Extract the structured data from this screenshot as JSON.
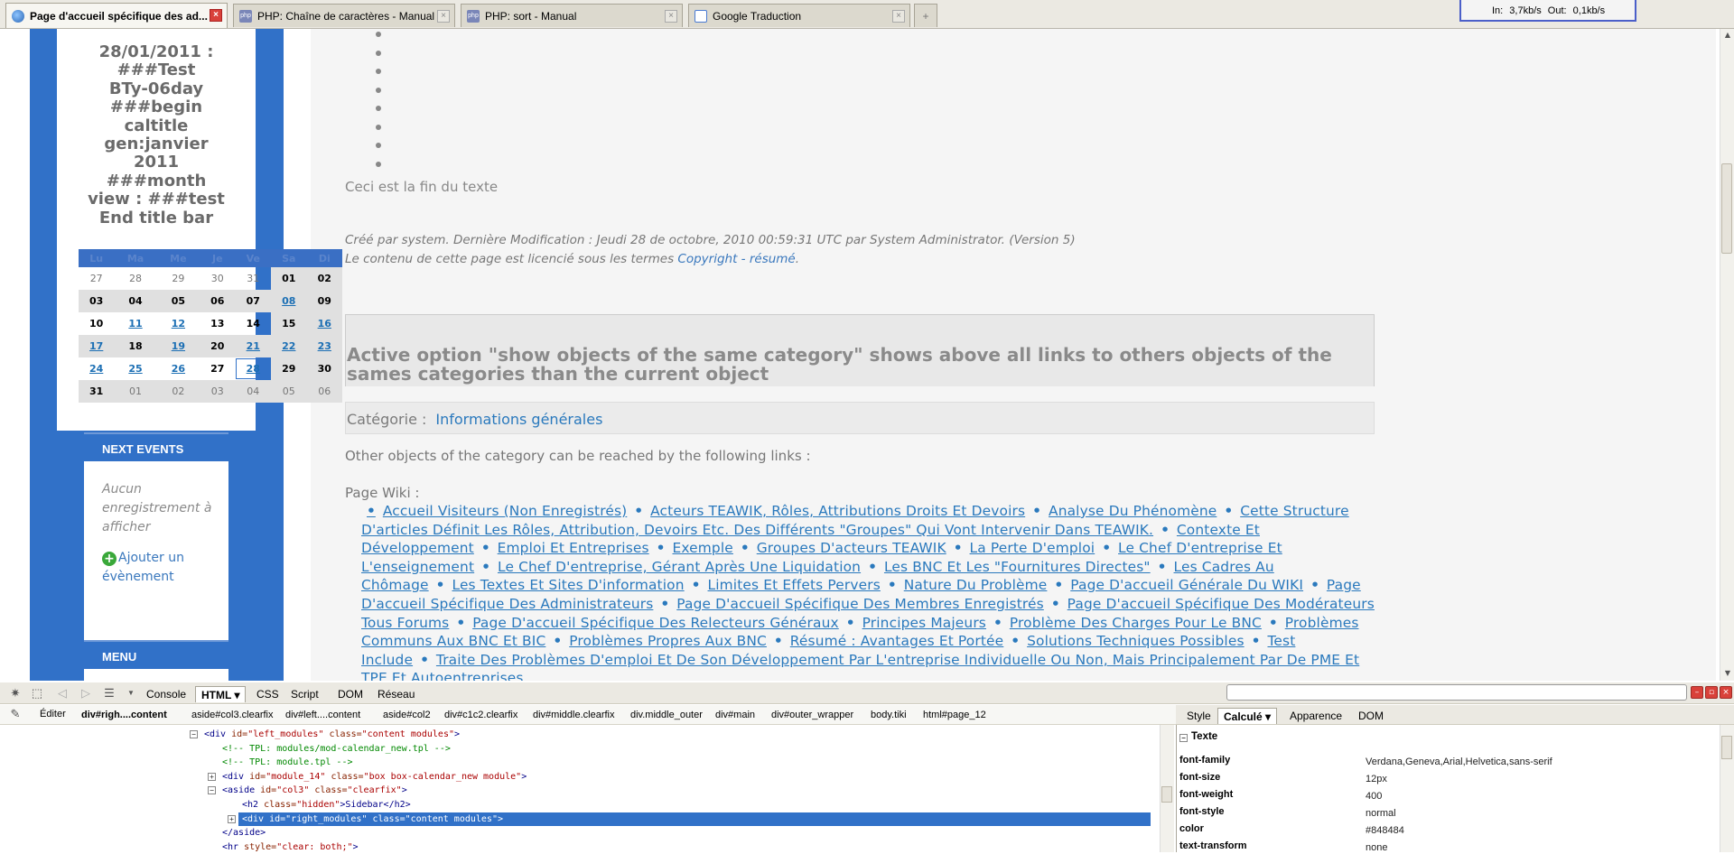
{
  "browser": {
    "tabs": [
      {
        "title": "Page d'accueil spécifique des ad...",
        "icon": "globe-icon",
        "active": true
      },
      {
        "title": "PHP: Chaîne de caractères - Manual",
        "icon": "php-icon",
        "active": false
      },
      {
        "title": "PHP: sort - Manual",
        "icon": "php-icon",
        "active": false
      },
      {
        "title": "Google Traduction",
        "icon": "google-icon",
        "active": false
      }
    ],
    "new_tab_symbol": "+",
    "close_symbol": "×",
    "net_monitor": "In: 3,7kb/s  Out: 0,1kb/s"
  },
  "sidebar": {
    "calendar_title_lines": [
      "28/01/2011 :",
      "###Test",
      "BTy-06day",
      "###begin",
      "caltitle",
      "gen:janvier",
      "2011",
      "###month",
      "view : ###test",
      "End title bar"
    ],
    "weekdays": [
      "Lu",
      "Ma",
      "Me",
      "Je",
      "Ve",
      "Sa",
      "Di"
    ],
    "weeks": [
      [
        "27",
        "28",
        "29",
        "30",
        "31",
        "01",
        "02"
      ],
      [
        "03",
        "04",
        "05",
        "06",
        "07",
        "08",
        "09"
      ],
      [
        "10",
        "11",
        "12",
        "13",
        "14",
        "15",
        "16"
      ],
      [
        "17",
        "18",
        "19",
        "20",
        "21",
        "22",
        "23"
      ],
      [
        "24",
        "25",
        "26",
        "27",
        "28",
        "29",
        "30"
      ],
      [
        "31",
        "01",
        "02",
        "03",
        "04",
        "05",
        "06"
      ]
    ],
    "next_events_title": "NEXT EVENTS",
    "no_events_text": "Aucun enregistrement à afficher",
    "add_event_label": "Ajouter un évènement",
    "menu_title": "MENU"
  },
  "main": {
    "end_text": "Ceci est la fin du texte",
    "meta_created": "Créé par system. Dernière Modification : Jeudi 28 de octobre, 2010 00:59:31 UTC par System Administrator. (Version 5)",
    "meta_license_prefix": "Le contenu de cette page est licencié sous les termes",
    "meta_license_link": "Copyright - résumé",
    "meta_license_suffix": ".",
    "option_text": "Active option \"show objects of the same category\" shows above all links to others objects of the sames categories than the current object",
    "category_label": "Catégorie :",
    "category_value": "Informations générales",
    "other_objects_text": "Other objects of the category can be reached by the following links :",
    "wiki_label": "Page Wiki :",
    "wiki_links": [
      "Accueil Visiteurs (Non Enregistrés)",
      "Acteurs TEAWIK, Rôles, Attributions Droits Et Devoirs",
      "Analyse Du Phénomène",
      "Cette Structure D'articles Définit Les Rôles, Attribution, Devoirs Etc. Des Différents \"Groupes\" Qui Vont Intervenir Dans TEAWIK.",
      "Contexte Et Développement",
      "Emploi Et Entreprises",
      "Exemple",
      "Groupes D'acteurs TEAWIK",
      "La Perte D'emploi",
      "Le Chef D'entreprise Et L'enseignement",
      "Le Chef D'entreprise, Gérant Après Une Liquidation",
      "Les BNC Et Les \"Fournitures Directes\"",
      "Les Cadres Au Chômage",
      "Les Textes Et Sites D'information",
      "Limites Et Effets Pervers",
      "Nature Du Problème",
      "Page D'accueil Générale Du WIKI",
      "Page D'accueil Spécifique Des Administrateurs",
      "Page D'accueil Spécifique Des Membres Enregistrés",
      "Page D'accueil Spécifique Des Modérateurs Tous Forums",
      "Page D'accueil Spécifique Des Relecteurs Généraux",
      "Principes Majeurs",
      "Problème Des Charges Pour Le BNC",
      "Problèmes Communs Aux BNC Et BIC",
      "Problèmes Propres Aux BNC",
      "Résumé : Avantages Et Portée",
      "Solutions Techniques Possibles",
      "Test Include",
      "Traite Des Problèmes D'emploi Et De Son Développement Par L'entreprise Individuelle Ou Non, Mais Principalement Par De PME Et TPE Et Autoentreprises"
    ]
  },
  "firebug": {
    "tabs": [
      "Console",
      "HTML",
      "CSS",
      "Script",
      "DOM",
      "Réseau"
    ],
    "active_tab": "HTML",
    "edit_label": "Éditer",
    "breadcrumbs": [
      "div#righ....content",
      "aside#col3.clearfix",
      "div#left....content",
      "aside#col2",
      "div#c1c2.clearfix",
      "div#middle.clearfix",
      "div.middle_outer",
      "div#main",
      "div#outer_wrapper",
      "body.tiki",
      "html#page_12"
    ],
    "html_lines": [
      {
        "t": "<div id=\"left_modules\" class=\"content modules\">"
      },
      {
        "t": "<!-- TPL: modules/mod-calendar_new.tpl -->"
      },
      {
        "t": "<!-- TPL: module.tpl -->"
      },
      {
        "t": "<div id=\"module_14\" class=\"box box-calendar_new module\">"
      },
      {
        "t": "<aside id=\"col3\" class=\"clearfix\">"
      },
      {
        "t": "<h2 class=\"hidden\">Sidebar</h2>"
      },
      {
        "t": "<div id=\"right_modules\" class=\"content modules\">"
      },
      {
        "t": "</aside>"
      },
      {
        "t": "<hr style=\"clear: both;\">"
      }
    ],
    "right_tabs": [
      "Style",
      "Calculé",
      "Apparence",
      "DOM"
    ],
    "right_active": "Calculé",
    "section_title": "Texte",
    "properties": [
      {
        "name": "font-family",
        "value": "Verdana,Geneva,Arial,Helvetica,sans-serif"
      },
      {
        "name": "font-size",
        "value": "12px"
      },
      {
        "name": "font-weight",
        "value": "400"
      },
      {
        "name": "font-style",
        "value": "normal"
      },
      {
        "name": "color",
        "value": "#848484"
      },
      {
        "name": "text-transform",
        "value": "none"
      }
    ]
  }
}
